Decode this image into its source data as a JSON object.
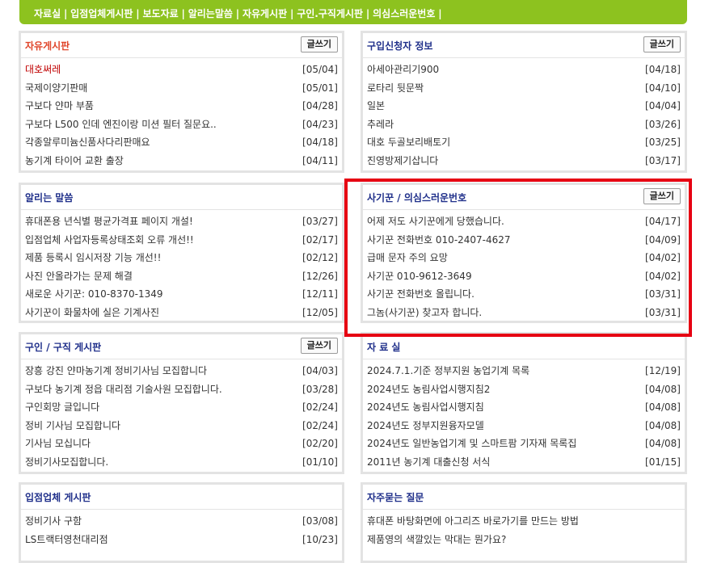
{
  "nav": {
    "items": [
      "자료실",
      "입점업체게시판",
      "보도자료",
      "알리는말씀",
      "자유게시판",
      "구인.구직게시판",
      "의심스러운번호"
    ],
    "separator": "|"
  },
  "write_label": "글쓰기",
  "boards": {
    "free": {
      "title": "자유게시판",
      "items": [
        {
          "title": "대호써레",
          "date": "[05/04]"
        },
        {
          "title": "국제이양기판매",
          "date": "[05/01]"
        },
        {
          "title": "구보다 얀마 부품",
          "date": "[04/28]"
        },
        {
          "title": "구보다 L500 인데 엔진이랑 미션 필터 질문요..",
          "date": "[04/23]"
        },
        {
          "title": "각종알루미늄신품사다리판매요",
          "date": "[04/18]"
        },
        {
          "title": "농기계 타이어 교환 출장",
          "date": "[04/11]"
        }
      ]
    },
    "purchase": {
      "title": "구입신청자 정보",
      "items": [
        {
          "title": "아세아관리기900",
          "date": "[04/18]"
        },
        {
          "title": "로타리 뒷문짝",
          "date": "[04/10]"
        },
        {
          "title": "일본",
          "date": "[04/04]"
        },
        {
          "title": "추레라",
          "date": "[03/26]"
        },
        {
          "title": "대호 두골보리배토기",
          "date": "[03/25]"
        },
        {
          "title": "진영방제기삽니다",
          "date": "[03/17]"
        }
      ]
    },
    "notice": {
      "title": "알리는 말씀",
      "items": [
        {
          "title": "휴대폰용 년식별 평균가격표 페이지 개설!",
          "date": "[03/27]"
        },
        {
          "title": "입점업체 사업자등록상태조회 오류 개선!!",
          "date": "[02/17]"
        },
        {
          "title": "제품 등록시 임시저장 기능 개선!!",
          "date": "[02/12]"
        },
        {
          "title": "사진 안올라가는 문제 해결",
          "date": "[12/26]"
        },
        {
          "title": "새로운 사기꾼: 010-8370-1349",
          "date": "[12/11]"
        },
        {
          "title": "사기꾼이 화물차에 실은 기계사진",
          "date": "[12/05]"
        }
      ]
    },
    "fraud": {
      "title": "사기꾼 / 의심스러운번호",
      "items": [
        {
          "title": "어제 저도 사기꾼에게 당했습니다.",
          "date": "[04/17]"
        },
        {
          "title": "사기꾼 전화번호 010-2407-4627",
          "date": "[04/09]"
        },
        {
          "title": "급매 문자 주의 요망",
          "date": "[04/02]"
        },
        {
          "title": "사기꾼 010-9612-3649",
          "date": "[04/02]"
        },
        {
          "title": "사기꾼 전화번호 올립니다.",
          "date": "[03/31]"
        },
        {
          "title": "그놈(사기꾼) 찾고자 합니다.",
          "date": "[03/31]"
        }
      ]
    },
    "jobs": {
      "title": "구인 / 구직 게시판",
      "items": [
        {
          "title": "장흥 강진 얀마농기계 정비기사님 모집합니다",
          "date": "[04/03]"
        },
        {
          "title": "구보다 농기계 정읍 대리점 기술사원 모집합니다.",
          "date": "[03/28]"
        },
        {
          "title": "구인회망 글입니다",
          "date": "[02/24]"
        },
        {
          "title": "정비 기사님 모집합니다",
          "date": "[02/24]"
        },
        {
          "title": "기사님 모십니다",
          "date": "[02/20]"
        },
        {
          "title": "정비기사모집합니다.",
          "date": "[01/10]"
        }
      ]
    },
    "archive": {
      "title": "자 료 실",
      "items": [
        {
          "title": "2024.7.1.기준 정부지원 농업기계 목록",
          "date": "[12/19]"
        },
        {
          "title": "2024년도 농림사업시행지침2",
          "date": "[04/08]"
        },
        {
          "title": "2024년도 농림사업시행지침",
          "date": "[04/08]"
        },
        {
          "title": "2024년도 정부지원융자모델",
          "date": "[04/08]"
        },
        {
          "title": "2024년도 일반농업기계 및 스마트팜 기자재 목록집",
          "date": "[04/08]"
        },
        {
          "title": "2011년 농기계 대출신청 서식",
          "date": "[01/15]"
        }
      ]
    },
    "vendor": {
      "title": "입점업체 게시판",
      "items": [
        {
          "title": "정비기사 구함",
          "date": "[03/08]"
        },
        {
          "title": "LS트랙터영천대리점",
          "date": "[10/23]"
        }
      ]
    },
    "faq": {
      "title": "자주묻는 질문",
      "items": [
        {
          "title": "휴대폰 바탕화면에 아그리즈 바로가기를 만드는 방법",
          "date": ""
        },
        {
          "title": "제품영의 색깔있는 막대는 뭔가요?",
          "date": ""
        }
      ]
    }
  }
}
